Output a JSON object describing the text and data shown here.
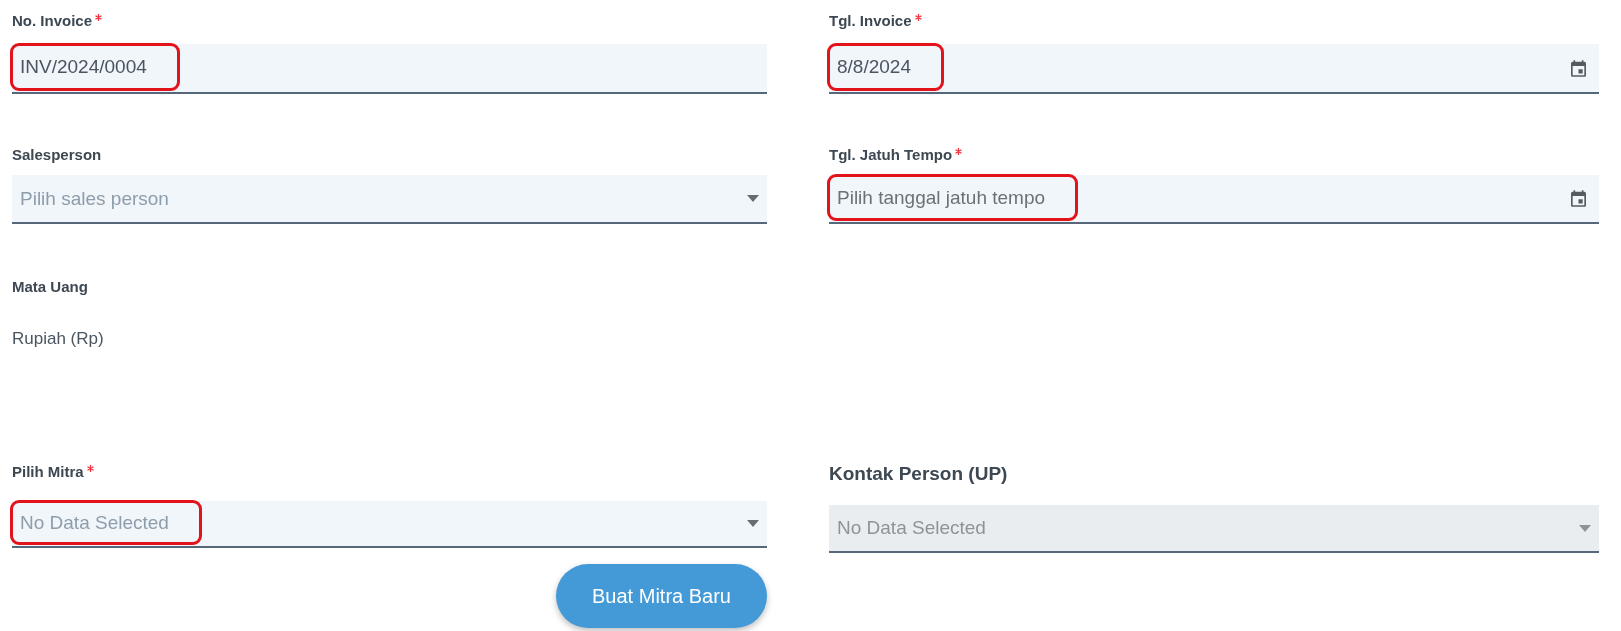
{
  "rows": [
    [
      {
        "kind": "text",
        "label": "No. Invoice",
        "required": true,
        "value": "INV/2024/0004",
        "highlighted": true,
        "disabled": false
      },
      {
        "kind": "date",
        "label": "Tgl. Invoice",
        "required": true,
        "value": "8/8/2024",
        "highlighted": true,
        "disabled": false
      }
    ],
    [
      {
        "kind": "select",
        "label": "Salesperson",
        "required": false,
        "placeholder": "Pilih sales person",
        "highlighted": false,
        "disabled": false
      },
      {
        "kind": "date",
        "label": "Tgl. Jatuh Tempo",
        "required": true,
        "placeholder": "Pilih tanggal jatuh tempo",
        "highlighted": true,
        "disabled": false
      }
    ],
    [
      {
        "kind": "display",
        "label": "Mata Uang",
        "required": false,
        "value": "Rupiah (Rp)",
        "highlighted": false,
        "disabled": false
      }
    ],
    [
      {
        "kind": "select",
        "label": "Pilih Mitra",
        "required": true,
        "placeholder": "No Data Selected",
        "highlighted": true,
        "disabled": false,
        "button": "Buat Mitra Baru"
      },
      {
        "kind": "linked",
        "label": "Kontak Person (UP)",
        "required": false,
        "placeholder": "No Data Selected",
        "highlighted": false,
        "disabled": true
      }
    ]
  ]
}
